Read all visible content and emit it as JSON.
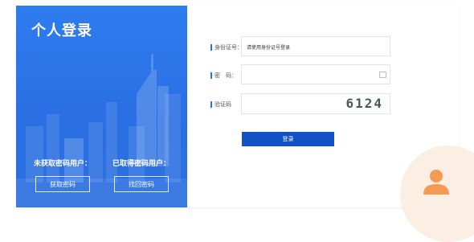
{
  "left": {
    "title": "个人登录",
    "hint_unregistered": "未获取密码用户：",
    "hint_registered": "已取得密码用户：",
    "get_password_label": "获取密码",
    "retrieve_password_label": "找回密码"
  },
  "form": {
    "id_label": "身份证号：",
    "id_placeholder": "请使用身份证号登录",
    "password_label": "密　码：",
    "captcha_label": "验证码",
    "captcha_code": "6124",
    "login_label": "登录"
  },
  "colors": {
    "brand_blue": "#2a6fe3",
    "button_blue": "#1252c5",
    "accent_orange": "#f59a52"
  },
  "icons": [
    "skyline-illustration",
    "lock-icon",
    "avatar-icon"
  ]
}
